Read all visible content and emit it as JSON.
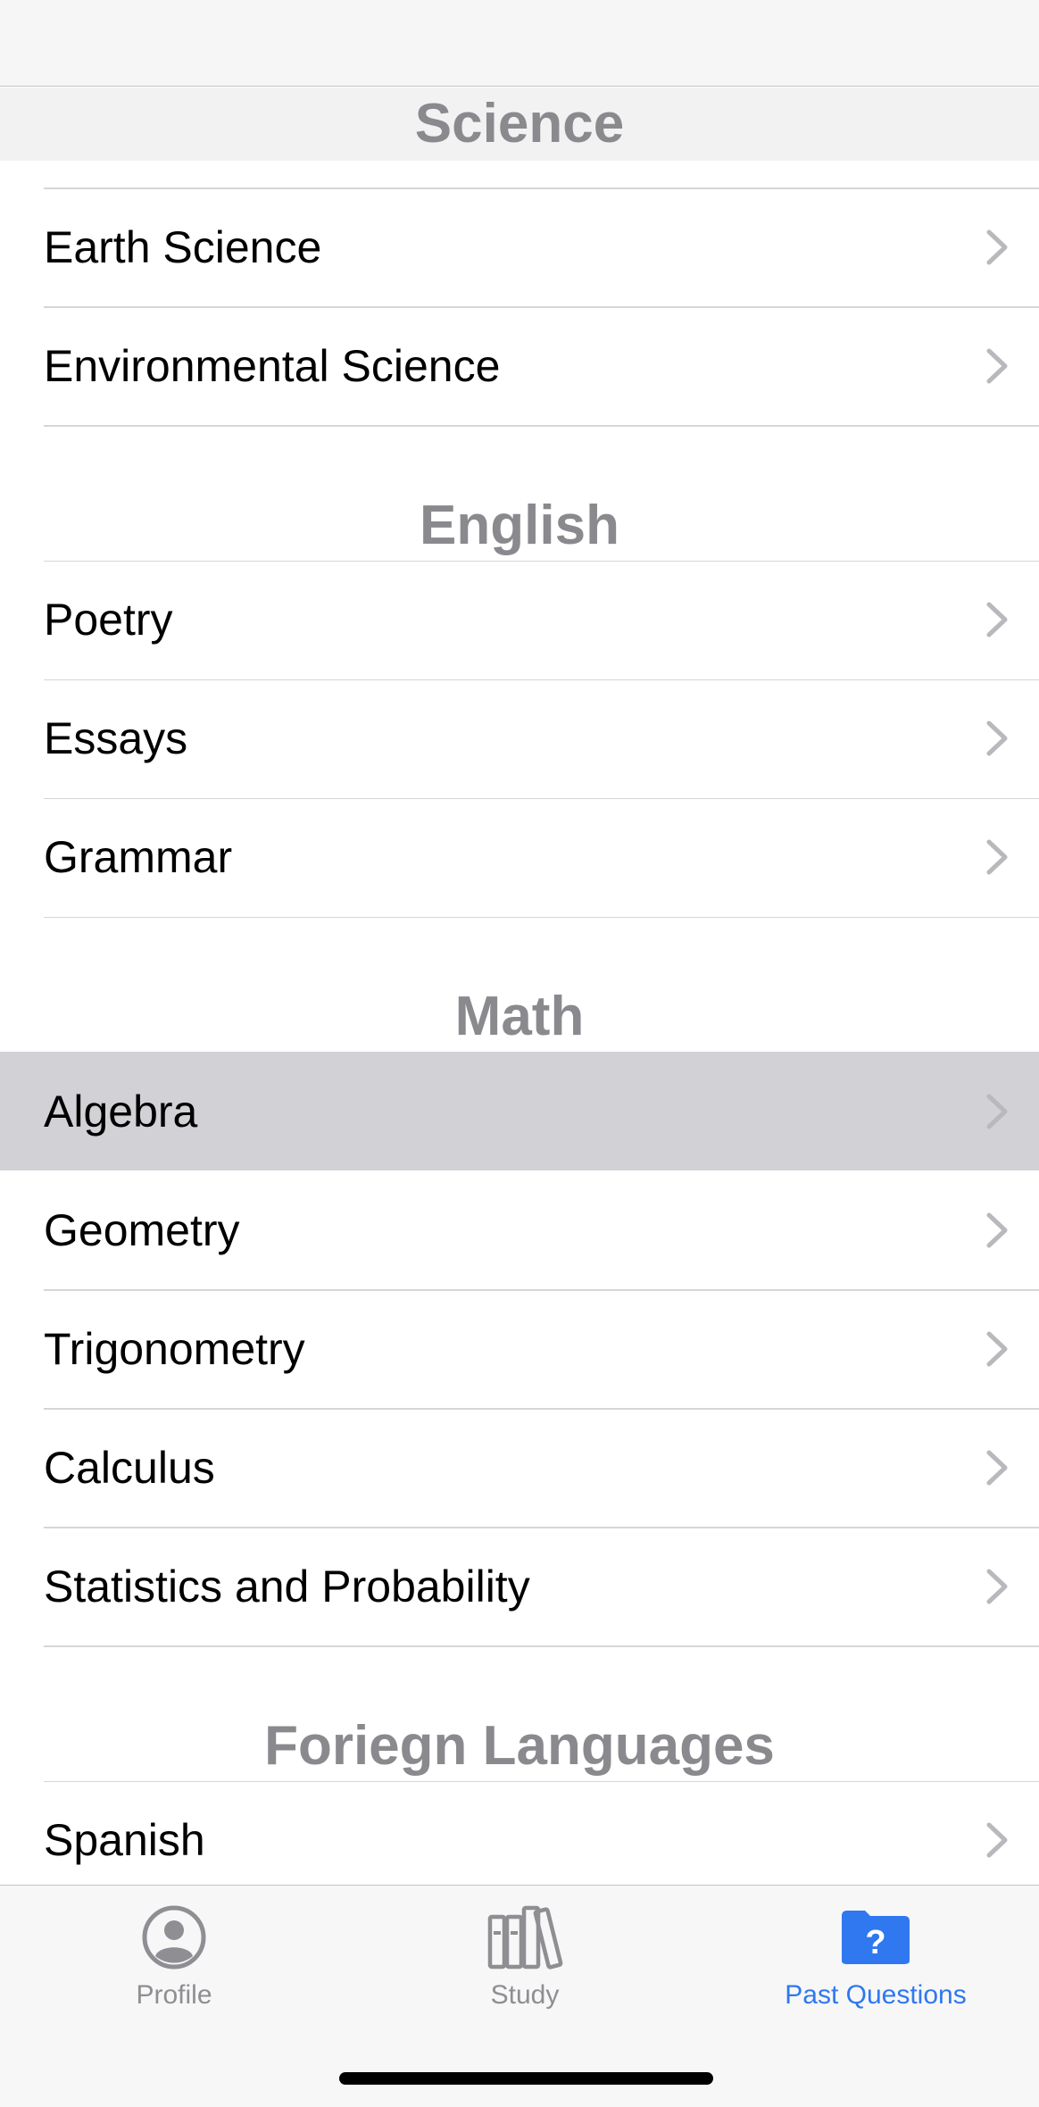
{
  "sections": [
    {
      "title": "Science",
      "items": [
        {
          "label": "Earth Science",
          "selected": false
        },
        {
          "label": "Environmental Science",
          "selected": false
        }
      ]
    },
    {
      "title": "English",
      "items": [
        {
          "label": "Poetry",
          "selected": false
        },
        {
          "label": "Essays",
          "selected": false
        },
        {
          "label": "Grammar",
          "selected": false
        }
      ]
    },
    {
      "title": "Math",
      "items": [
        {
          "label": "Algebra",
          "selected": true
        },
        {
          "label": "Geometry",
          "selected": false
        },
        {
          "label": "Trigonometry",
          "selected": false
        },
        {
          "label": "Calculus",
          "selected": false
        },
        {
          "label": "Statistics and Probability",
          "selected": false
        }
      ]
    },
    {
      "title": "Foriegn Languages",
      "items": [
        {
          "label": "Spanish",
          "selected": false
        }
      ]
    }
  ],
  "tab_bar": {
    "tabs": [
      {
        "label": "Profile",
        "icon": "person-circle-icon",
        "active": false
      },
      {
        "label": "Study",
        "icon": "books-icon",
        "active": false
      },
      {
        "label": "Past Questions",
        "icon": "question-folder-icon",
        "active": true
      }
    ]
  },
  "colors": {
    "accent": "#2f78f0",
    "section_header": "#8a8a8e",
    "selected_row": "#d1d1d6",
    "chevron": "#b8b8bd",
    "inactive_tab": "#8e8e93"
  }
}
